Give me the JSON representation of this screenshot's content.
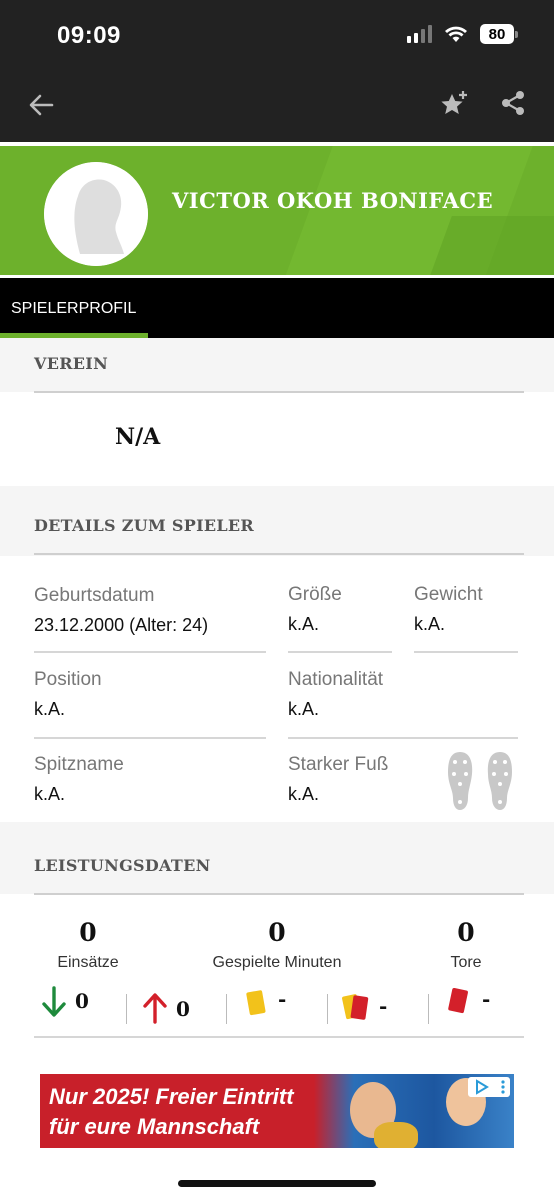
{
  "status_bar": {
    "time": "09:09",
    "battery": "80",
    "icons": [
      "signal-icon",
      "wifi-icon",
      "battery-icon"
    ]
  },
  "app_bar": {
    "icons": [
      "back-arrow-icon",
      "favorite-star-plus-icon",
      "share-icon"
    ]
  },
  "player": {
    "name": "VICTOR OKOH BONIFACE"
  },
  "tabs": [
    {
      "label": "SPIELERPROFIL",
      "active": true
    }
  ],
  "club_section": {
    "title": "VEREIN",
    "value": "N/A"
  },
  "details": {
    "title": "DETAILS ZUM SPIELER",
    "birth_label": "Geburtsdatum",
    "birth_value": "23.12.2000 (Alter: 24)",
    "height_label": "Größe",
    "height_value": "k.A.",
    "weight_label": "Gewicht",
    "weight_value": "k.A.",
    "position_label": "Position",
    "position_value": "k.A.",
    "nationality_label": "Nationalität",
    "nationality_value": "k.A.",
    "nickname_label": "Spitzname",
    "nickname_value": "k.A.",
    "foot_label": "Starker Fuß",
    "foot_value": "k.A."
  },
  "performance": {
    "title": "LEISTUNGSDATEN",
    "appearances_value": "0",
    "appearances_label": "Einsätze",
    "minutes_value": "0",
    "minutes_label": "Gespielte Minuten",
    "goals_value": "0",
    "goals_label": "Tore",
    "subbed_out": "0",
    "subbed_in": "0",
    "yellow_cards": "-",
    "yellow_red_cards": "-",
    "red_cards": "-"
  },
  "ad": {
    "line1": "Nur 2025! Freier Eintritt",
    "line2": "für eure Mannschaft"
  },
  "colors": {
    "dark": "#222222",
    "green": "#6db12c",
    "sub_out": "#1e8a3c",
    "sub_in": "#d3202a",
    "yellow_card": "#f2c21b",
    "red_card": "#d3202a"
  }
}
